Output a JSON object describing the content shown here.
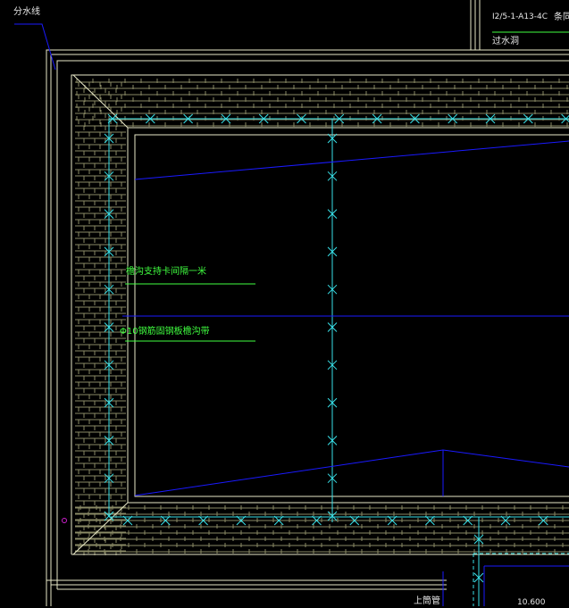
{
  "labels": {
    "water_divide": "分水线",
    "top_code": "I2/5-1-A13-4C",
    "top_right": "条同",
    "top_sub": "过水洞",
    "support_note": "檐沟支持卡间隔一米",
    "pipe_note": "Φ10钢筋固钢板檐沟带",
    "bottom_left": "上筒管",
    "bottom_right": "10.600"
  },
  "colors": {
    "background": "#000000",
    "frame": "#e8e8c8",
    "hatch": "#8a8a66",
    "cyan": "#38e0e8",
    "blue": "#1a1aff",
    "green": "#40ff40",
    "label": "#e8e8e8",
    "magenta": "#d020d0"
  }
}
